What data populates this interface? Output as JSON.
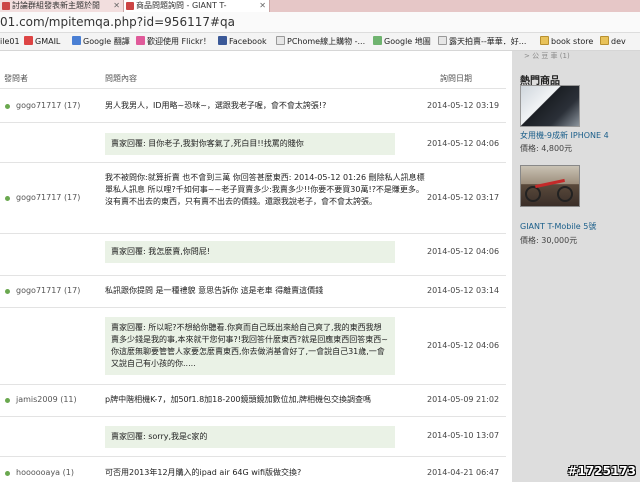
{
  "browser": {
    "tabs": [
      {
        "label": "討論群組發表新主題於閒"
      },
      {
        "label": "商品問題詢問 - GIANT T-"
      }
    ],
    "url": "01.com/mpitemqa.php?id=956117#qa",
    "bookmarks": [
      {
        "label": "ile01"
      },
      {
        "label": "GMAIL"
      },
      {
        "label": "Google 翻譯"
      },
      {
        "label": "歡迎使用 Flickr！"
      },
      {
        "label": "Facebook"
      },
      {
        "label": "PChome線上購物 -..."
      },
      {
        "label": "Google 地圖"
      },
      {
        "label": "露天拍賣--華華．好..."
      },
      {
        "label": "book store"
      },
      {
        "label": "dev"
      }
    ]
  },
  "colors": {
    "accent": "#6aa84f",
    "reply_bg": "#eaf2e6",
    "sidebar_bg": "#dddddd",
    "link": "#1a5e8a"
  },
  "qa": {
    "headers": {
      "asker": "發問者",
      "content": "問題內容",
      "date": "詢問日期"
    },
    "rows": [
      {
        "asker": "gogo71717 (17)",
        "question": "男人我男人，ID用略~恐咪~，選跟我老子喔，會不會太誇張!?",
        "date": "2014-05-12 03:19",
        "reply": "賣家回覆: 目你老子,我對你客氣了,死白目!!找罵的賤你",
        "reply_date": "2014-05-12 04:06"
      },
      {
        "asker": "gogo71717 (17)",
        "question": "我不被問你:就算折賣 也不會到三萬 你回答甚麼東西: 2014-05-12 01:26 刪除私人訊息標單私人訊息 所以哩?千如何事~~老子買賣多少:我賣多少!!你要不要買30萬!?不是賺更多。沒有賣不出去的東西，只有賣不出去的價錢。還跟我說老子，會不會太誇張。",
        "date": "2014-05-12 03:17",
        "reply": "賣家回覆: 我怎麼賣,你問屁!",
        "reply_date": "2014-05-12 04:06"
      },
      {
        "asker": "gogo71717 (17)",
        "question": "私訊跟你提問 是一種禮貌 意思告訴你 這是老車 得離賣這價錢",
        "date": "2014-05-12 03:14",
        "reply": "賣家回覆: 所以呢?不想給你聽看.你爽而自己既出來給自己爽了,我的東西我想賣多少錢是我的事,本來就干您何事?!我回答什麼東西?就是回應東西回答東西~你這麼無聊要管管人家要怎麼賣東西,你去做消基會好了,一會說自己31歲,一會又說自己有小孩的你.....",
        "reply_date": "2014-05-12 04:06"
      },
      {
        "asker": "jamis2009 (11)",
        "question": "p牌中階相機K-7，加50f1.8加18-200鏡頭鏡加數位加,牌相機包交換調查嗎",
        "date": "2014-05-09 21:02",
        "reply": "賣家回覆: sorry,我是c家的",
        "reply_date": "2014-05-10 13:07"
      },
      {
        "asker": "hoooooaya (1)",
        "question": "可否用2013年12月購入的ipad air 64G wifi版做交換?",
        "date": "2014-04-21 06:47"
      }
    ]
  },
  "sidebar": {
    "top_text": "> 公 豆 車 (1)",
    "title": "熱門商品",
    "items": [
      {
        "image": "phone-photo",
        "name": "女用機-9成新 IPHONE 4",
        "price": "價格: 4,800元"
      },
      {
        "image": "bicycle-photo",
        "name": "GIANT T-Mobile 5號",
        "price": "價格: 30,000元"
      }
    ]
  },
  "watermark": "#1725173"
}
